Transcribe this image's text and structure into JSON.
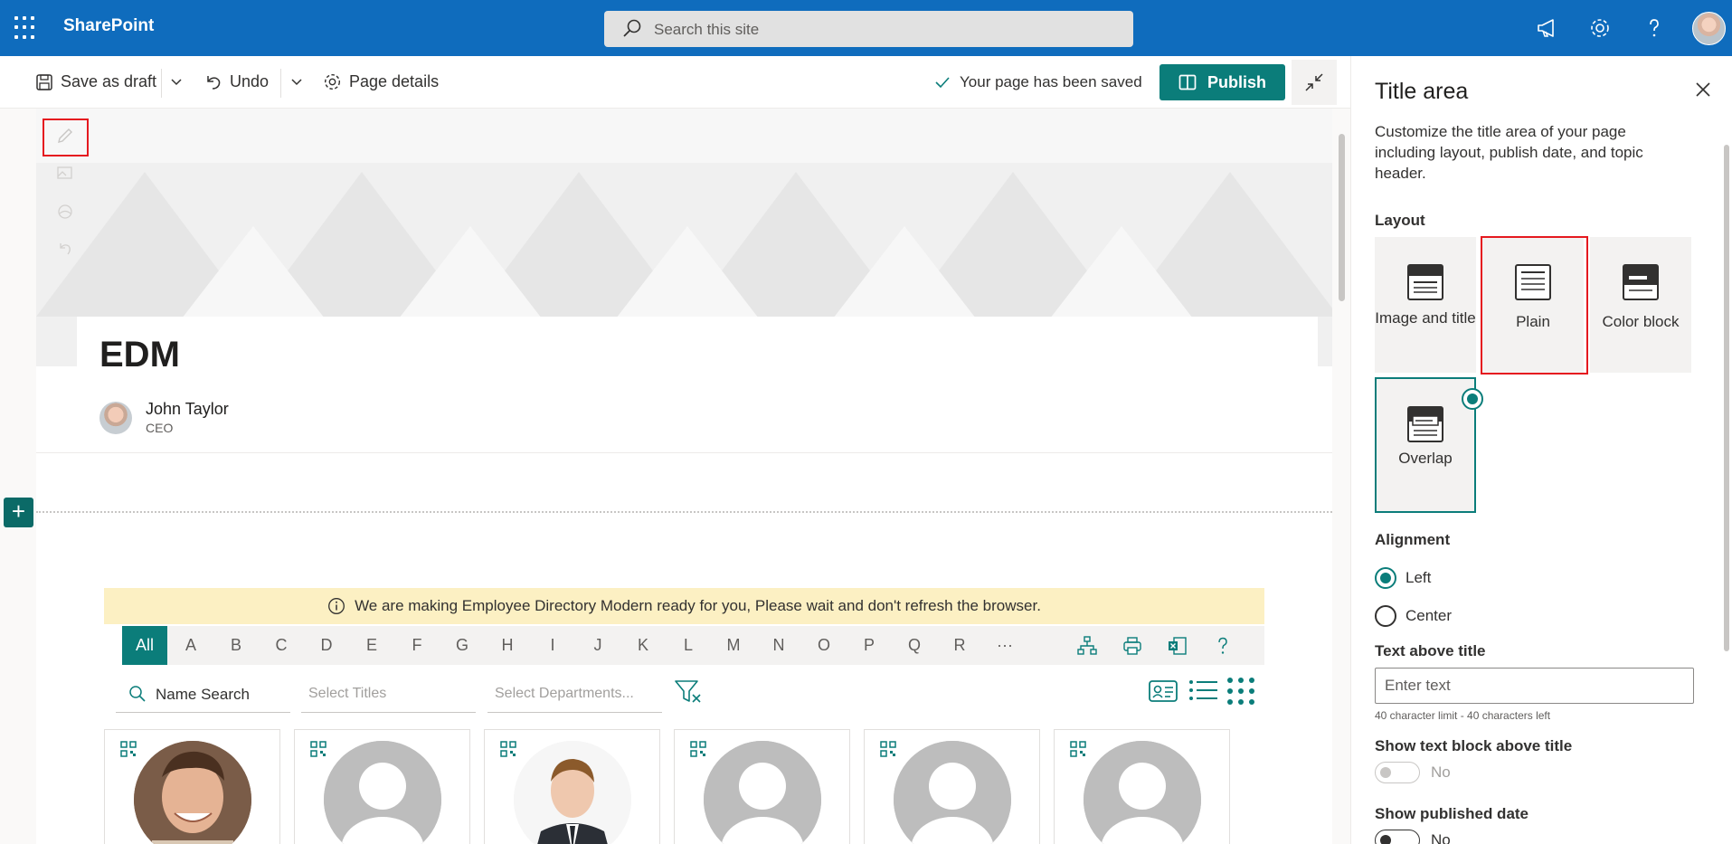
{
  "suite": {
    "brand": "SharePoint",
    "search_placeholder": "Search this site"
  },
  "commandbar": {
    "save_draft": "Save as draft",
    "undo": "Undo",
    "page_details": "Page details",
    "saved_status": "Your page has been saved",
    "publish": "Publish"
  },
  "page": {
    "title": "EDM",
    "author_name": "John Taylor",
    "author_role": "CEO"
  },
  "directory": {
    "notice": "We are making Employee Directory Modern ready for you, Please wait and don't refresh the browser.",
    "letters": [
      "All",
      "A",
      "B",
      "C",
      "D",
      "E",
      "F",
      "G",
      "H",
      "I",
      "J",
      "K",
      "L",
      "M",
      "N",
      "O",
      "P",
      "Q",
      "R",
      "···"
    ],
    "name_search": "Name Search",
    "titles_placeholder": "Select Titles",
    "departments_placeholder": "Select Departments..."
  },
  "panel": {
    "title": "Title area",
    "description": "Customize the title area of your page including layout, publish date, and topic header.",
    "layout_label": "Layout",
    "layouts": [
      "Image and title",
      "Plain",
      "Color block",
      "Overlap"
    ],
    "selected_layout": "Overlap",
    "alignment_label": "Alignment",
    "alignment_left": "Left",
    "alignment_center": "Center",
    "alignment_selected": "Left",
    "text_above_label": "Text above title",
    "text_above_placeholder": "Enter text",
    "text_above_hint": "40 character limit - 40 characters left",
    "show_text_block_label": "Show text block above title",
    "show_text_block_value": "No",
    "show_published_label": "Show published date",
    "show_published_value": "No"
  },
  "colors": {
    "suite_blue": "#0f6cbd",
    "accent_teal": "#0b7d7a",
    "highlight_red": "#e5191f",
    "notice_yellow": "#fcf0c3"
  }
}
